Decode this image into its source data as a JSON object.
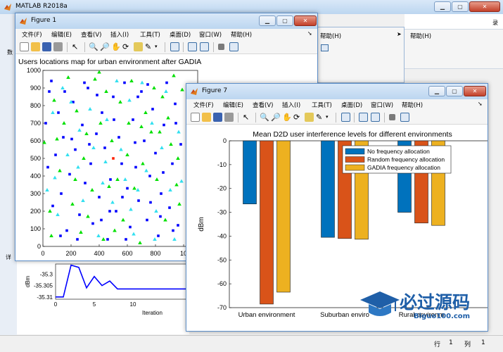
{
  "matlab": {
    "title": "MATLAB R2018a",
    "side_tabs": [
      "录",
      "数"
    ],
    "help": "帮助(H)"
  },
  "back_window": {
    "help": "帮助(H)",
    "partial_label": "详"
  },
  "figure1": {
    "title": "Figure 1",
    "menu": [
      "文件(F)",
      "编辑(E)",
      "查看(V)",
      "插入(I)",
      "工具(T)",
      "桌面(D)",
      "窗口(W)",
      "帮助(H)"
    ],
    "chart_data": {
      "type": "scatter",
      "title": "Users locations map for urban environment after GADIA",
      "xlim": [
        0,
        1000
      ],
      "ylim": [
        0,
        1000
      ],
      "xticks": [
        "0",
        "200",
        "400",
        "600",
        "800",
        "10"
      ],
      "yticks": [
        "0",
        "100",
        "200",
        "300",
        "400",
        "500",
        "600",
        "700",
        "800",
        "900",
        "1000"
      ],
      "series": [
        {
          "marker": "square",
          "color": "#0000ff",
          "points": [
            [
              20,
              700
            ],
            [
              45,
              880
            ],
            [
              60,
              940
            ],
            [
              90,
              520
            ],
            [
              110,
              760
            ],
            [
              130,
              300
            ],
            [
              145,
              620
            ],
            [
              170,
              90
            ],
            [
              190,
              410
            ],
            [
              215,
              820
            ],
            [
              230,
              550
            ],
            [
              260,
              180
            ],
            [
              280,
              690
            ],
            [
              300,
              360
            ],
            [
              320,
              900
            ],
            [
              340,
              470
            ],
            [
              355,
              130
            ],
            [
              380,
              640
            ],
            [
              400,
              280
            ],
            [
              420,
              760
            ],
            [
              440,
              560
            ],
            [
              460,
              40
            ],
            [
              480,
              380
            ],
            [
              500,
              850
            ],
            [
              520,
              200
            ],
            [
              540,
              620
            ],
            [
              560,
              470
            ],
            [
              580,
              930
            ],
            [
              600,
              330
            ],
            [
              620,
              110
            ],
            [
              640,
              720
            ],
            [
              660,
              450
            ],
            [
              680,
              260
            ],
            [
              700,
              880
            ],
            [
              720,
              600
            ],
            [
              740,
              150
            ],
            [
              760,
              400
            ],
            [
              780,
              780
            ],
            [
              800,
              530
            ],
            [
              820,
              60
            ],
            [
              840,
              300
            ],
            [
              860,
              690
            ],
            [
              880,
              930
            ],
            [
              900,
              220
            ],
            [
              920,
              470
            ],
            [
              940,
              810
            ],
            [
              960,
              120
            ],
            [
              980,
              580
            ],
            [
              70,
              230
            ],
            [
              155,
              880
            ],
            [
              245,
              40
            ],
            [
              330,
              580
            ],
            [
              415,
              150
            ],
            [
              505,
              720
            ],
            [
              590,
              40
            ],
            [
              675,
              850
            ],
            [
              765,
              250
            ],
            [
              855,
              420
            ],
            [
              945,
              700
            ],
            [
              35,
              450
            ],
            [
              125,
              60
            ],
            [
              205,
              610
            ],
            [
              295,
              930
            ],
            [
              385,
              860
            ],
            [
              475,
              200
            ],
            [
              565,
              280
            ],
            [
              655,
              590
            ],
            [
              745,
              920
            ],
            [
              835,
              170
            ],
            [
              925,
              90
            ]
          ]
        },
        {
          "marker": "triangle",
          "color": "#00e000",
          "points": [
            [
              10,
              590
            ],
            [
              50,
              200
            ],
            [
              80,
              830
            ],
            [
              120,
              430
            ],
            [
              150,
              700
            ],
            [
              180,
              960
            ],
            [
              210,
              240
            ],
            [
              240,
              770
            ],
            [
              270,
              80
            ],
            [
              290,
              500
            ],
            [
              310,
              640
            ],
            [
              350,
              320
            ],
            [
              370,
              950
            ],
            [
              410,
              700
            ],
            [
              430,
              40
            ],
            [
              450,
              880
            ],
            [
              490,
              600
            ],
            [
              510,
              90
            ],
            [
              530,
              380
            ],
            [
              550,
              820
            ],
            [
              570,
              150
            ],
            [
              610,
              700
            ],
            [
              630,
              940
            ],
            [
              650,
              330
            ],
            [
              690,
              20
            ],
            [
              710,
              470
            ],
            [
              730,
              760
            ],
            [
              770,
              650
            ],
            [
              790,
              900
            ],
            [
              810,
              380
            ],
            [
              850,
              850
            ],
            [
              870,
              150
            ],
            [
              890,
              730
            ],
            [
              910,
              580
            ],
            [
              930,
              970
            ],
            [
              950,
              350
            ],
            [
              970,
              240
            ],
            [
              990,
              890
            ],
            [
              60,
              60
            ],
            [
              100,
              610
            ],
            [
              230,
              380
            ],
            [
              320,
              170
            ],
            [
              400,
              990
            ],
            [
              470,
              340
            ],
            [
              600,
              520
            ],
            [
              700,
              680
            ],
            [
              830,
              650
            ],
            [
              960,
              500
            ]
          ]
        },
        {
          "marker": "triangle",
          "color": "#33e0f0",
          "points": [
            [
              30,
              320
            ],
            [
              70,
              760
            ],
            [
              105,
              180
            ],
            [
              140,
              900
            ],
            [
              175,
              520
            ],
            [
              200,
              820
            ],
            [
              250,
              450
            ],
            [
              285,
              260
            ],
            [
              335,
              780
            ],
            [
              360,
              560
            ],
            [
              395,
              60
            ],
            [
              425,
              360
            ],
            [
              455,
              720
            ],
            [
              495,
              250
            ],
            [
              525,
              940
            ],
            [
              555,
              550
            ],
            [
              585,
              380
            ],
            [
              615,
              830
            ],
            [
              645,
              70
            ],
            [
              675,
              320
            ],
            [
              705,
              930
            ],
            [
              735,
              430
            ],
            [
              775,
              700
            ],
            [
              805,
              200
            ],
            [
              845,
              560
            ],
            [
              875,
              880
            ],
            [
              905,
              320
            ],
            [
              935,
              40
            ],
            [
              965,
              650
            ],
            [
              985,
              370
            ],
            [
              85,
              390
            ],
            [
              260,
              660
            ],
            [
              445,
              480
            ],
            [
              625,
              210
            ],
            [
              795,
              40
            ]
          ]
        },
        {
          "marker": "square",
          "color": "#ff2000",
          "points": [
            [
              500,
              500
            ]
          ]
        }
      ]
    }
  },
  "figure7": {
    "title": "Figure 7",
    "menu": [
      "文件(F)",
      "编辑(E)",
      "查看(V)",
      "插入(I)",
      "工具(T)",
      "桌面(D)",
      "窗口(W)",
      "帮助(H)"
    ],
    "chart_data": {
      "type": "bar",
      "title": "Mean D2D user interference levels for different environments",
      "ylabel": "dBm",
      "ylim": [
        -70,
        0
      ],
      "yticks": [
        "0",
        "-10",
        "-20",
        "-30",
        "-40",
        "-50",
        "-60",
        "-70"
      ],
      "categories": [
        "Urban environment",
        "Suburban enviro",
        "Rural environm"
      ],
      "series": [
        {
          "name": "No frequency allocation",
          "color": "#0072bd",
          "values": [
            -26.5,
            -40.5,
            -30
          ]
        },
        {
          "name": "Random frequency allocation",
          "color": "#d95319",
          "values": [
            -68.5,
            -41,
            -34.5
          ]
        },
        {
          "name": "GADIA frequency allocation",
          "color": "#edb120",
          "values": [
            -63.5,
            -41.3,
            -35.5
          ]
        }
      ]
    }
  },
  "bottom_plot": {
    "chart_data": {
      "type": "line",
      "ylabel": "dBm",
      "xlabel": "Iteration",
      "xticks": [
        "0",
        "5",
        "10"
      ],
      "yticks": [
        "-35.3",
        "-35.305",
        "-35.31"
      ],
      "xlim": [
        0,
        17
      ],
      "ylim": [
        -35.311,
        -35.2955
      ],
      "series": [
        {
          "color": "#0000ff",
          "points": [
            [
              0,
              -35.31
            ],
            [
              1,
              -35.31
            ],
            [
              2,
              -35.296
            ],
            [
              3,
              -35.297
            ],
            [
              4,
              -35.306
            ],
            [
              5,
              -35.301
            ],
            [
              6,
              -35.305
            ],
            [
              7,
              -35.303
            ],
            [
              8,
              -35.3065
            ],
            [
              17,
              -35.3065
            ]
          ]
        }
      ]
    }
  },
  "watermark": {
    "text": "必过源码",
    "url": "Biguo100.com"
  },
  "statusbar": {
    "row_label": "行",
    "row_value": "1",
    "col_label": "列",
    "col_value": "1"
  }
}
